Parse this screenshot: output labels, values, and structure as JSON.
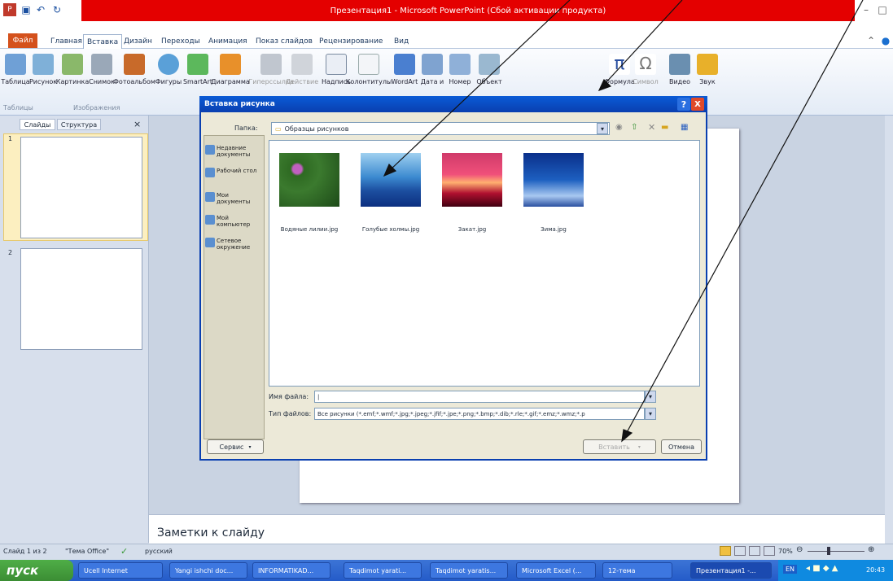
{
  "window": {
    "title": "Презентация1 - Microsoft PowerPoint (Сбой активации продукта)"
  },
  "ribbon_tabs": [
    "Файл",
    "Главная",
    "Вставка",
    "Дизайн",
    "Переходы",
    "Анимация",
    "Показ слайдов",
    "Рецензирование",
    "Вид"
  ],
  "ribbon_buttons": [
    "Таблица",
    "Рисунок",
    "Картинка",
    "Снимок",
    "Фотоальбом",
    "Фигуры",
    "SmartArt",
    "Диаграмма",
    "Гиперссылка",
    "Действие",
    "Надпись",
    "Колонтитулы",
    "WordArt",
    "Дата и",
    "Номер",
    "Объект",
    "Формула",
    "Символ",
    "Видео",
    "Звук"
  ],
  "ribbon_groups": [
    "Таблицы",
    "Изображения"
  ],
  "left_panel": {
    "tabs": [
      "Слайды",
      "Структура"
    ],
    "close": "×",
    "slide_numbers": [
      "1",
      "2"
    ]
  },
  "notes": "Заметки к слайду",
  "status": {
    "slide_info": "Слайд 1 из 2",
    "theme": "\"Тема Office\"",
    "lang": "русский",
    "zoom": "70%"
  },
  "taskbar": {
    "start": "пуск",
    "items": [
      "Ucell Internet",
      "Yangi ishchi doc...",
      "INFORMATIKAD...",
      "Taqdimot yarati...",
      "Taqdimot yaratis...",
      "Microsoft Excel (...",
      "12-тема",
      "Презентация1 -..."
    ],
    "clock": "20:43",
    "lang": "EN"
  },
  "dialog": {
    "title": "Вставка рисунка",
    "help": "?",
    "close": "X",
    "lookin_label": "Папка:",
    "lookin_value": "Образцы рисунков",
    "places": [
      "Недавние документы",
      "Рабочий стол",
      "Мои документы",
      "Мой компьютер",
      "Сетевое окружение"
    ],
    "files": [
      "Водяные лилии.jpg",
      "Голубые холмы.jpg",
      "Закат.jpg",
      "Зима.jpg"
    ],
    "filename_label": "Имя файла:",
    "filename_value": "|",
    "filetype_label": "Тип файлов:",
    "filetype_value": "Все рисунки (*.emf;*.wmf;*.jpg;*.jpeg;*.jfif;*.jpe;*.png;*.bmp;*.dib;*.rle;*.gif;*.emz;*.wmz;*.p",
    "service_button": "Сервис",
    "insert_button": "Вставить",
    "cancel_button": "Отмена"
  },
  "colors": {
    "title_red": "#e40000",
    "dialog_title": "#0a3fb0",
    "taskbar": "#245bc8",
    "start": "#3b8d34"
  }
}
